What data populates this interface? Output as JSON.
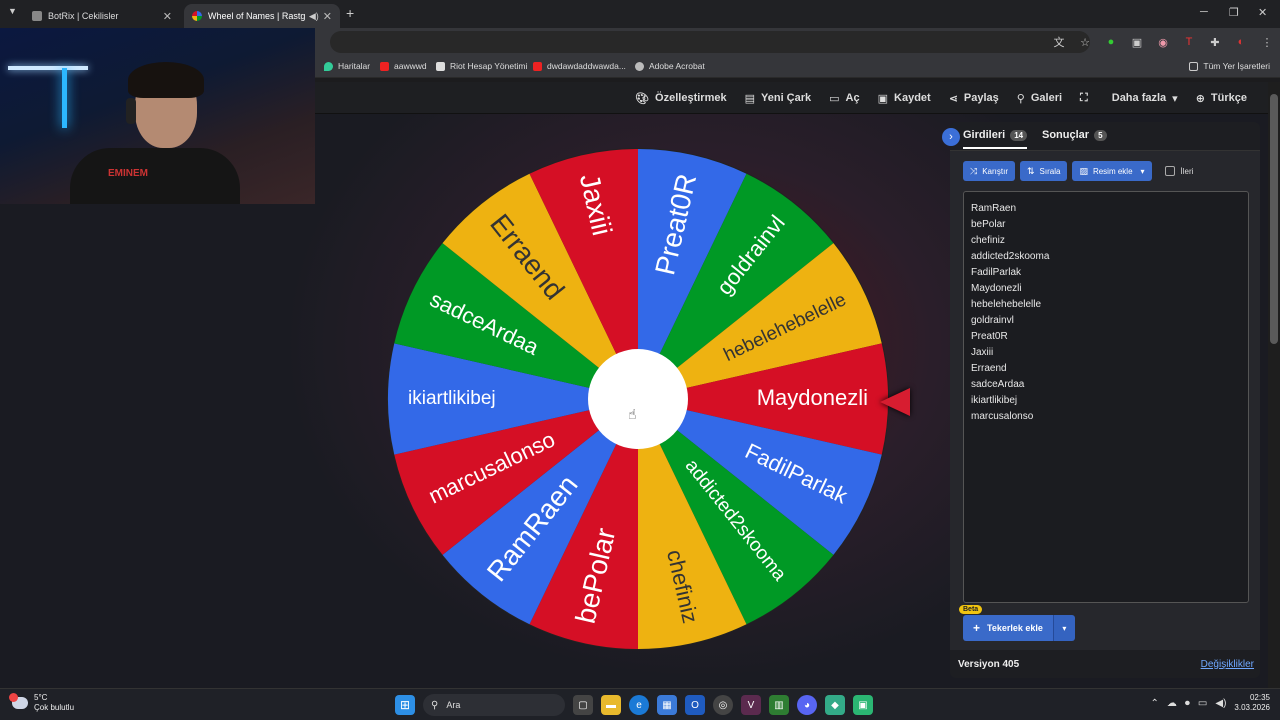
{
  "browser": {
    "tabs": [
      {
        "title": "BotRix | Cekilisler",
        "active": false
      },
      {
        "title": "Wheel of Names | Rastgele",
        "active": true
      }
    ],
    "new_tab": "+",
    "bookmarks": [
      "Haritalar",
      "aawwwd",
      "Riot Hesap Yönetimi",
      "dwdawdaddwawda...",
      "Adobe Acrobat"
    ],
    "all_bookmarks": "Tüm Yer İşaretleri"
  },
  "site": {
    "nav": [
      {
        "icon": "palette-icon",
        "label": "Özelleştirmek"
      },
      {
        "icon": "file-icon",
        "label": "Yeni Çark"
      },
      {
        "icon": "folder-open-icon",
        "label": "Aç"
      },
      {
        "icon": "save-icon",
        "label": "Kaydet"
      },
      {
        "icon": "share-icon",
        "label": "Paylaş"
      },
      {
        "icon": "search-icon",
        "label": "Galeri"
      },
      {
        "icon": "fullscreen-icon",
        "label": ""
      },
      {
        "icon": "chevron-down-icon",
        "label": "Daha fazla"
      },
      {
        "icon": "globe-icon",
        "label": "Türkçe"
      }
    ]
  },
  "wheel": {
    "segments": [
      {
        "label": "Preat0R",
        "color": "#3369e8"
      },
      {
        "label": "goldrainvl",
        "color": "#009925"
      },
      {
        "label": "hebelehebelelle",
        "color": "#eeb211"
      },
      {
        "label": "Maydonezli",
        "color": "#d50f25"
      },
      {
        "label": "FadilParlak",
        "color": "#3369e8"
      },
      {
        "label": "addicted2skooma",
        "color": "#009925"
      },
      {
        "label": "chefiniz",
        "color": "#eeb211"
      },
      {
        "label": "bePolar",
        "color": "#d50f25"
      },
      {
        "label": "RamRaen",
        "color": "#3369e8"
      },
      {
        "label": "marcusalonso",
        "color": "#d50f25"
      },
      {
        "label": "ikiartlikibej",
        "color": "#3369e8"
      },
      {
        "label": "sadceArdaa",
        "color": "#009925"
      },
      {
        "label": "Erraend",
        "color": "#eeb211"
      },
      {
        "label": "Jaxiii",
        "color": "#d50f25"
      }
    ]
  },
  "panel": {
    "tab_entries": "Girdileri",
    "entries_count": "14",
    "tab_results": "Sonuçlar",
    "results_count": "5",
    "btn_shuffle": "Karıştır",
    "btn_sort": "Sırala",
    "btn_add_image": "Resim ekle",
    "chk_advanced": "İleri",
    "entries": [
      "RamRaen",
      "bePolar",
      "chefiniz",
      "addicted2skooma",
      "FadilParlak",
      "Maydonezli",
      "hebelehebelelle",
      "goldrainvl",
      "Preat0R",
      "Jaxiii",
      "Erraend",
      "sadceArdaa",
      "ikiartlikibej",
      "marcusalonso"
    ],
    "beta": "Beta",
    "btn_add_wheel": "Tekerlek ekle",
    "version": "Versiyon 405",
    "changes": "Değişiklikler"
  },
  "webcam": {
    "shirt_text": "EMINEM"
  },
  "taskbar": {
    "temp": "5°C",
    "weather": "Çok bulutlu",
    "search": "Ara",
    "time": "02:35",
    "date": "3.03.2026"
  }
}
